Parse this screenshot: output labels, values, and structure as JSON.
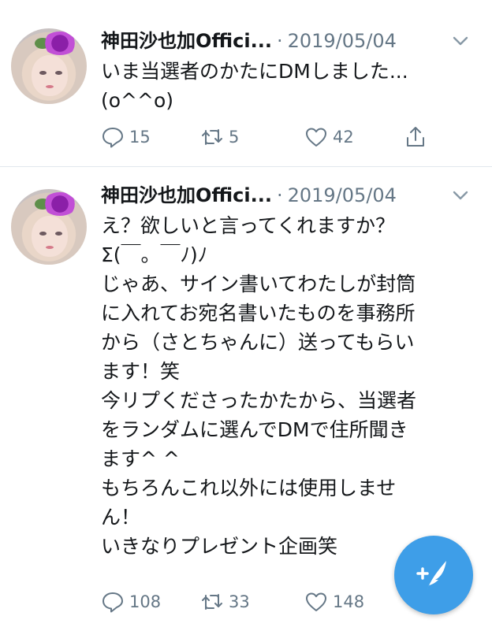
{
  "tweets": [
    {
      "name": "神田沙也加Offici...",
      "separator": "·",
      "date": "2019/05/04",
      "text": "いま当選者のかたにDMしました...\n(o^^o)",
      "replies": "15",
      "retweets": "5",
      "likes": "42"
    },
    {
      "name": "神田沙也加Offici...",
      "separator": "·",
      "date": "2019/05/04",
      "text": "え？欲しいと言ってくれますか？\nΣ(￣。￣ﾉ)ﾉ\nじゃあ、サイン書いてわたしが封筒\nに入れてお宛名書いたものを事務所\nから（さとちゃんに）送ってもらい\nます！笑\n今リプくださったかたから、当選者\nをランダムに選んでDMで住所聞き\nます^ ^\nもちろんこれ以外には使用しませ\nん！\nいきなりプレゼント企画笑",
      "replies": "108",
      "retweets": "33",
      "likes": "148"
    }
  ],
  "colors": {
    "text": "#14171a",
    "muted": "#657786",
    "accent": "#3e9ee8",
    "divider": "#e1e8ed"
  },
  "icons": {
    "reply": "reply-icon",
    "retweet": "retweet-icon",
    "like": "heart-icon",
    "share": "share-icon",
    "more": "chevron-down-icon",
    "compose": "compose-tweet-icon"
  }
}
